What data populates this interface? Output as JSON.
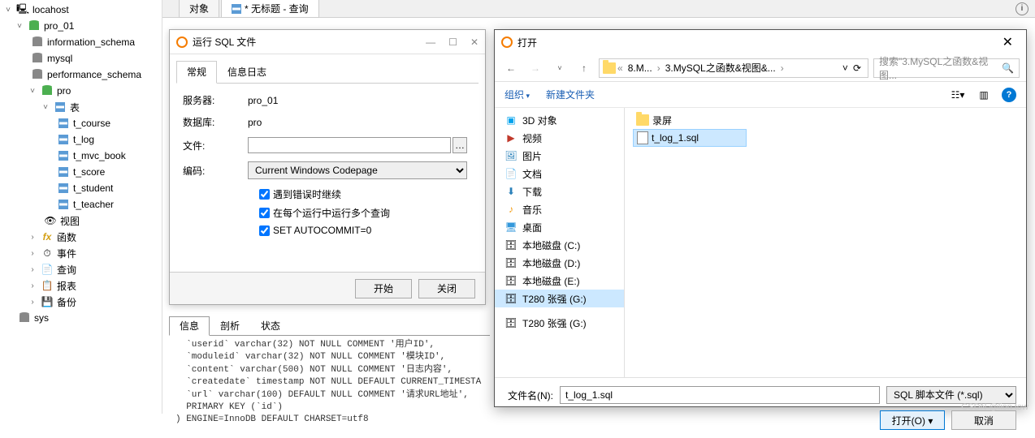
{
  "toolbar": {
    "tab1": "对象",
    "tab2": "* 无标题 - 查询"
  },
  "tree": {
    "root": "locahost",
    "db1": "pro_01",
    "schemas": [
      "information_schema",
      "mysql",
      "performance_schema"
    ],
    "active_db": "pro",
    "tables_label": "表",
    "tables": [
      "t_course",
      "t_log",
      "t_mvc_book",
      "t_score",
      "t_student",
      "t_teacher"
    ],
    "views": "视图",
    "functions": "函数",
    "events": "事件",
    "queries": "查询",
    "reports": "报表",
    "backups": "备份",
    "sys": "sys"
  },
  "sql_dialog": {
    "title": "运行 SQL 文件",
    "tab_general": "常规",
    "tab_log": "信息日志",
    "server_label": "服务器:",
    "server_value": "pro_01",
    "db_label": "数据库:",
    "db_value": "pro",
    "file_label": "文件:",
    "file_value": "",
    "encoding_label": "编码:",
    "encoding_value": "Current Windows Codepage",
    "chk1": "遇到错误时继续",
    "chk2": "在每个运行中运行多个查询",
    "chk3": "SET AUTOCOMMIT=0",
    "btn_start": "开始",
    "btn_close": "关闭"
  },
  "bottom": {
    "tab_info": "信息",
    "tab_profile": "剖析",
    "tab_status": "状态",
    "code": "  `userid` varchar(32) NOT NULL COMMENT '用户ID',\n  `moduleid` varchar(32) NOT NULL COMMENT '模块ID',\n  `content` varchar(500) NOT NULL COMMENT '日志内容',\n  `createdate` timestamp NOT NULL DEFAULT CURRENT_TIMESTA\n  `url` varchar(100) DEFAULT NULL COMMENT '请求URL地址',\n  PRIMARY KEY (`id`)\n) ENGINE=InnoDB DEFAULT CHARSET=utf8"
  },
  "file_dialog": {
    "title": "打开",
    "breadcrumb": [
      "8.M...",
      "3.MySQL之函数&视图&..."
    ],
    "search_placeholder": "搜索\"3.MySQL之函数&视图...",
    "organize": "组织",
    "newfolder": "新建文件夹",
    "sidebar_items": [
      {
        "label": "3D 对象",
        "icon": "3d"
      },
      {
        "label": "视频",
        "icon": "video"
      },
      {
        "label": "图片",
        "icon": "image"
      },
      {
        "label": "文档",
        "icon": "doc"
      },
      {
        "label": "下载",
        "icon": "download"
      },
      {
        "label": "音乐",
        "icon": "music"
      },
      {
        "label": "桌面",
        "icon": "desktop"
      },
      {
        "label": "本地磁盘 (C:)",
        "icon": "disk"
      },
      {
        "label": "本地磁盘 (D:)",
        "icon": "disk"
      },
      {
        "label": "本地磁盘 (E:)",
        "icon": "disk"
      },
      {
        "label": "T280 张强 (G:)",
        "icon": "disk"
      },
      {
        "label": "T280 张强 (G:)",
        "icon": "disk"
      }
    ],
    "files": [
      {
        "name": "录屏",
        "type": "folder"
      },
      {
        "name": "t_log_1.sql",
        "type": "file",
        "selected": true
      }
    ],
    "filename_label": "文件名(N):",
    "filename_value": "t_log_1.sql",
    "filetype": "SQL 脚本文件 (*.sql)",
    "btn_open": "打开(O)",
    "btn_cancel": "取消"
  },
  "watermark": "CSDN @lion tow"
}
